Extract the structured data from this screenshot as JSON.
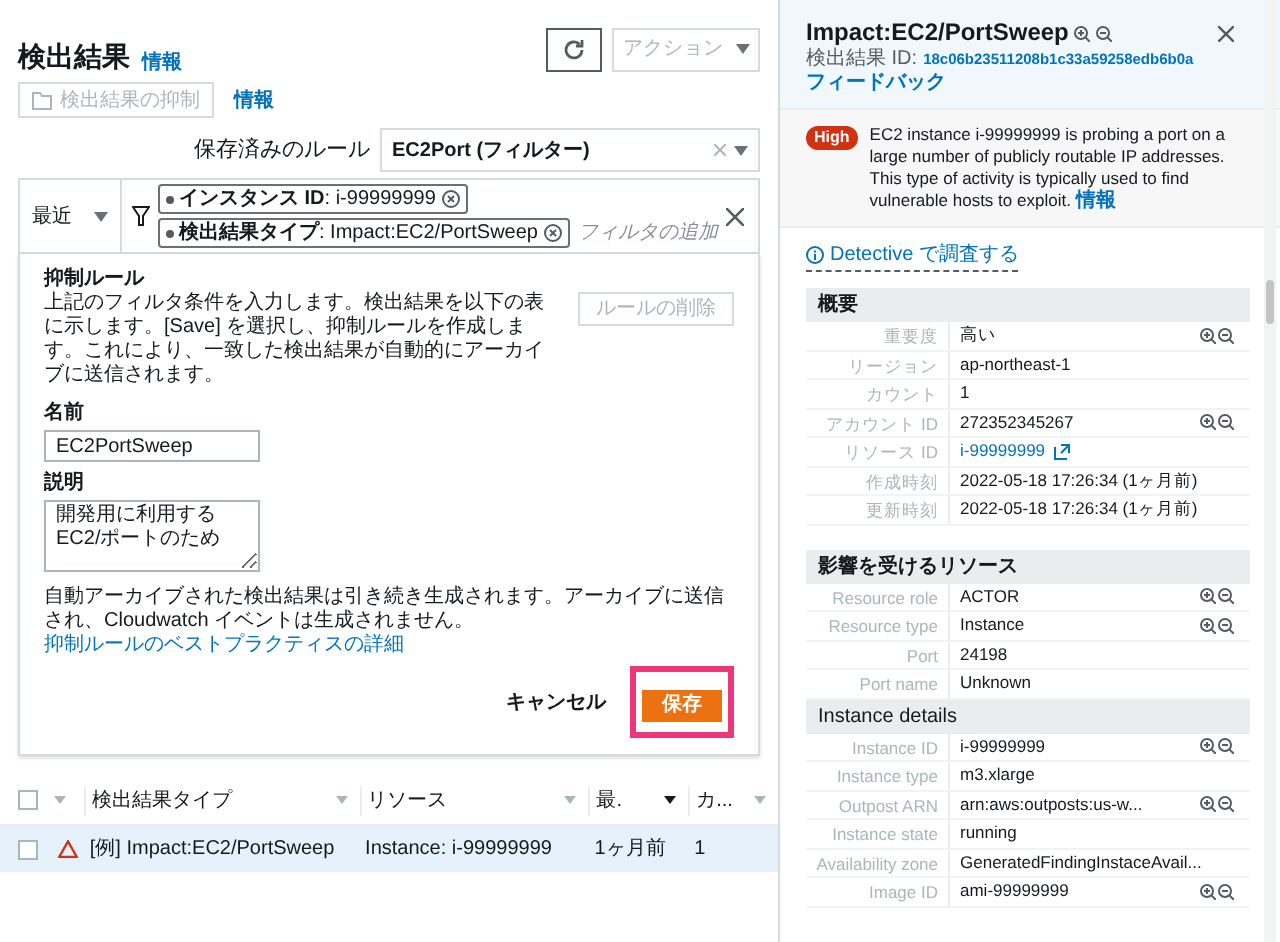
{
  "findings": {
    "title": "検出結果",
    "info": "情報",
    "suppress_button": "検出結果の抑制",
    "suppress_info": "情報",
    "action_button": "アクション",
    "saved_rules_label": "保存済みのルール",
    "saved_rule_value": "EC2Port (フィルター)",
    "period": "最近",
    "filter_chips": [
      "**インスタンス ID**: i-99999999",
      "**検出結果タイプ**: Impact:EC2/PortSweep"
    ],
    "filter_placeholder": "フィルタの追加"
  },
  "suppression_form": {
    "heading": "抑制ルール",
    "description": "上記のフィルタ条件を入力します。検出結果を以下の表に示します。[Save] を選択し、抑制ルールを作成します。これにより、一致した検出結果が自動的にアーカイブに送信されます。",
    "delete_button": "ルールの削除",
    "name_label": "名前",
    "name_value": "EC2PortSweep",
    "description_label": "説明",
    "description_value": "開発用に利用するEC2/ポートのため",
    "note": "自動アーカイブされた検出結果は引き続き生成されます。アーカイブに送信され、Cloudwatch イベントは生成されません。",
    "link": "抑制ルールのベストプラクティスの詳細",
    "cancel_button": "キャンセル",
    "save_button": "保存",
    "save_highlighted": true
  },
  "table": {
    "all_selected": false,
    "columns": [
      "検出結果タイプ",
      "リソース",
      "最.",
      "カ..."
    ],
    "rows": [
      {
        "checked": false,
        "selected": true,
        "cells": [
          "[例] Impact:EC2/PortSweep",
          "Instance: i-99999999",
          "1ヶ月前",
          "1"
        ]
      }
    ]
  },
  "detail": {
    "title": "Impact:EC2/PortSweep",
    "id_label": "検出結果 ID:",
    "id_value": "18c06b23511208b1c33a59258edb6b0a",
    "feedback": "フィードバック",
    "severity": "High",
    "description": "EC2 instance i-99999999 is probing a port on a large number of publicly routable IP addresses. This type of activity is typically used to find vulnerable hosts to exploit.",
    "info": "情報",
    "detective_link": "Detective で調査する",
    "sections": [
      {
        "kind": "section",
        "title": "概要",
        "rows": [
          {
            "label": "重要度",
            "value": "高い",
            "kind": "text",
            "zoom": true
          },
          {
            "label": "リージョン",
            "value": "ap-northeast-1",
            "kind": "text",
            "zoom": false
          },
          {
            "label": "カウント",
            "value": "1",
            "kind": "text",
            "zoom": false
          },
          {
            "label": "アカウント ID",
            "value": "272352345267",
            "kind": "text",
            "zoom": true
          },
          {
            "label": "リソース ID",
            "value": "i-99999999",
            "kind": "link",
            "zoom": false
          },
          {
            "label": "作成時刻",
            "value": "2022-05-18 17:26:34 (1ヶ月前)",
            "kind": "text",
            "zoom": false
          },
          {
            "label": "更新時刻",
            "value": "2022-05-18 17:26:34 (1ヶ月前)",
            "kind": "text",
            "zoom": false
          }
        ]
      },
      {
        "kind": "section",
        "title": "影響を受けるリソース",
        "rows": [
          {
            "label": "Resource role",
            "value": "ACTOR",
            "kind": "text",
            "zoom": true
          },
          {
            "label": "Resource type",
            "value": "Instance",
            "kind": "text",
            "zoom": true
          },
          {
            "label": "Port",
            "value": "24198",
            "kind": "text",
            "zoom": false
          },
          {
            "label": "Port name",
            "value": "Unknown",
            "kind": "text",
            "zoom": false
          }
        ]
      },
      {
        "kind": "subsection",
        "title": "Instance details",
        "rows": [
          {
            "label": "Instance ID",
            "value": "i-99999999",
            "kind": "text",
            "zoom": true
          },
          {
            "label": "Instance type",
            "value": "m3.xlarge",
            "kind": "text",
            "zoom": false
          },
          {
            "label": "Outpost ARN",
            "value": "arn:aws:outposts:us-w...",
            "kind": "text",
            "zoom": true
          },
          {
            "label": "Instance state",
            "value": "running",
            "kind": "text",
            "zoom": false
          },
          {
            "label": "Availability zone",
            "value": "GeneratedFindingInstaceAvail...",
            "kind": "text",
            "zoom": false
          },
          {
            "label": "Image ID",
            "value": "ami-99999999",
            "kind": "text",
            "zoom": true
          }
        ]
      }
    ]
  }
}
